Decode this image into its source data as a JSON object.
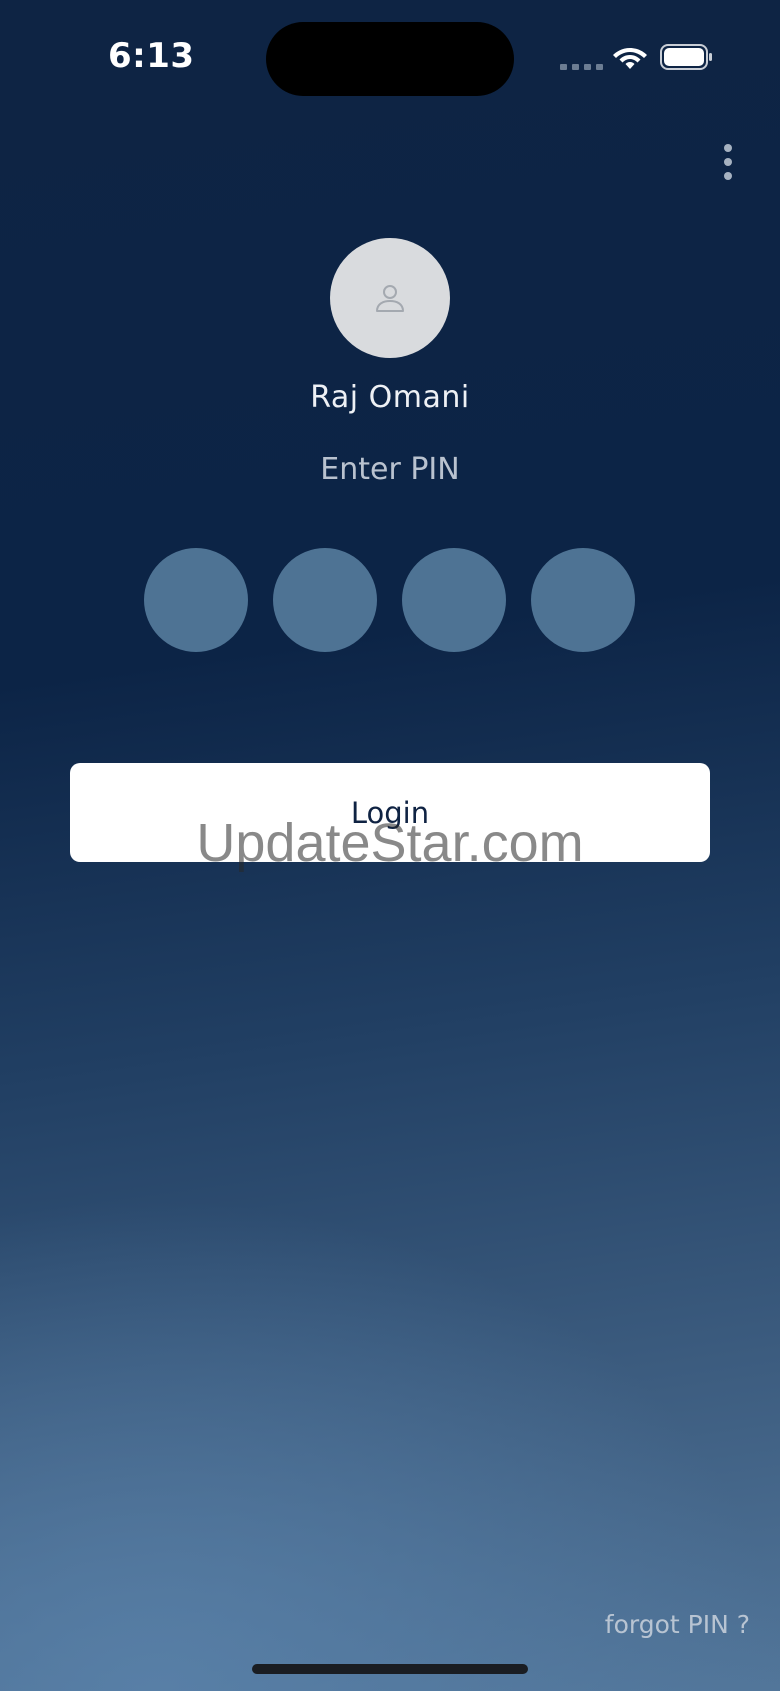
{
  "status_bar": {
    "time": "6:13",
    "icons": [
      "cellular-signal-icon",
      "wifi-icon",
      "battery-icon"
    ]
  },
  "menu": {
    "icon": "more-vertical-icon"
  },
  "user": {
    "avatar_icon": "person-icon",
    "name": "Raj Omani"
  },
  "pin": {
    "prompt": "Enter PIN",
    "digits_entered": 0,
    "length": 4
  },
  "login": {
    "label": "Login"
  },
  "watermark": {
    "text": "UpdateStar.com"
  },
  "footer": {
    "forgot_pin": "forgot PIN ?"
  },
  "colors": {
    "background_top": "#0c2446",
    "background_bottom": "#52769a",
    "pin_dot": "#4e7394",
    "button_bg": "#ffffff",
    "button_text": "#0f2343"
  }
}
